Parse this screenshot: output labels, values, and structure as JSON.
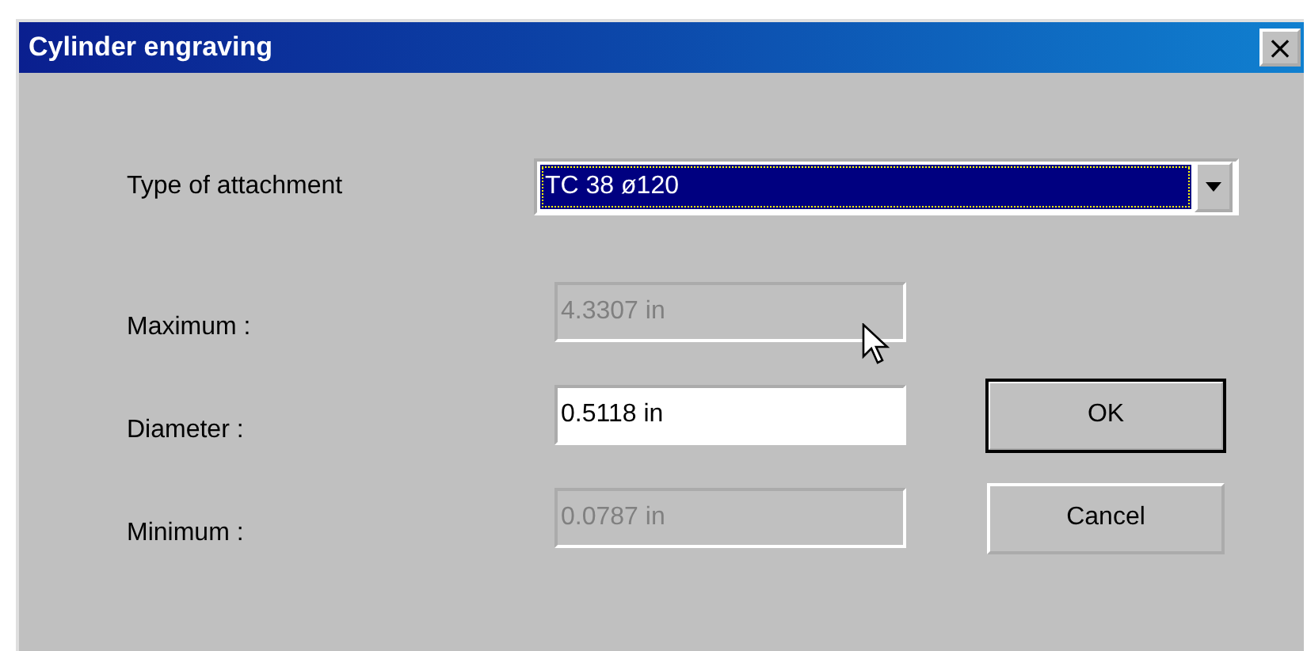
{
  "window": {
    "title": "Cylinder engraving",
    "close": "×"
  },
  "attachment": {
    "label": "Type of attachment",
    "value": "TC 38 ø120"
  },
  "fields": [
    {
      "label": "Maximum :",
      "value": "4.3307 in",
      "disabled": true
    },
    {
      "label": "Diameter :",
      "value": "0.5118 in",
      "disabled": false
    },
    {
      "label": "Minimum :",
      "value": "0.0787 in",
      "disabled": true
    }
  ],
  "buttons": [
    {
      "label": "OK",
      "default": true
    },
    {
      "label": "Cancel",
      "default": false
    }
  ]
}
